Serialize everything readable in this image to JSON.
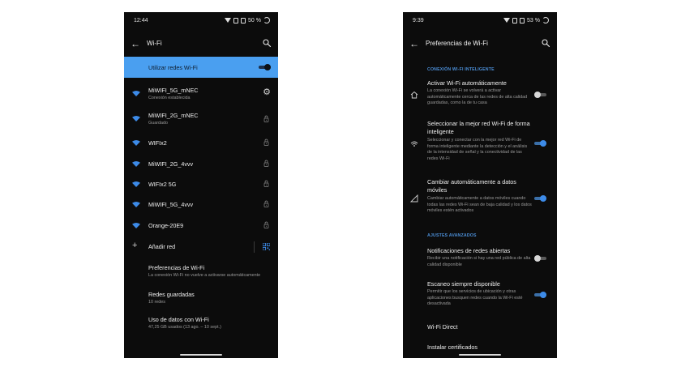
{
  "left_phone": {
    "status": {
      "time": "12:44",
      "battery": "50 %"
    },
    "title": "Wi-Fi",
    "toggle_row": {
      "label": "Utilizar redes Wi-Fi",
      "on": true
    },
    "networks": [
      {
        "name": "MiWIFI_5G_mNEC",
        "status": "Conexión establecida",
        "trailing": "gear-icon"
      },
      {
        "name": "MiWIFI_2G_mNEC",
        "status": "Guardado",
        "trailing": "lock-icon"
      },
      {
        "name": "WIFIx2",
        "status": "",
        "trailing": "lock-icon"
      },
      {
        "name": "MiWIFI_2G_4vvv",
        "status": "",
        "trailing": "lock-icon"
      },
      {
        "name": "WIFIx2 5G",
        "status": "",
        "trailing": "lock-icon"
      },
      {
        "name": "MiWIFI_5G_4vvv",
        "status": "",
        "trailing": "lock-icon"
      },
      {
        "name": "Orange-20E9",
        "status": "",
        "trailing": "lock-icon"
      }
    ],
    "add_network": "Añadir red",
    "menu": [
      {
        "title": "Preferencias de Wi-Fi",
        "subtitle": "La conexión Wi-Fi no vuelve a activarse automáticamente"
      },
      {
        "title": "Redes guardadas",
        "subtitle": "10 redes"
      },
      {
        "title": "Uso de datos con Wi-Fi",
        "subtitle": "47,25 GB usados (13 ago. – 10 sept.)"
      }
    ]
  },
  "right_phone": {
    "status": {
      "time": "9:39",
      "battery": "53 %"
    },
    "title": "Preferencias de Wi-Fi",
    "section1": "CONEXIÓN WI-FI INTELIGENTE",
    "smart_items": [
      {
        "title": "Activar Wi-Fi automáticamente",
        "desc": "La conexión Wi-Fi se volverá a activar automáticamente cerca de las redes de alta calidad guardadas, como la de tu casa",
        "on": false,
        "icon": "home-icon"
      },
      {
        "title": "Seleccionar la mejor red Wi-Fi de forma inteligente",
        "desc": "Seleccionar y conectar con la mejor red Wi-Fi de forma inteligente mediante la detección y el análisis de la intensidad de señal y la conectividad de las redes Wi-Fi",
        "on": true,
        "icon": "wifi-smart-icon"
      },
      {
        "title": "Cambiar automáticamente a datos móviles",
        "desc": "Cambiar automáticamente a datos móviles cuando todas las redes Wi-Fi sean de baja calidad y los datos móviles estén activados",
        "on": true,
        "icon": "mobile-data-icon"
      }
    ],
    "section2": "AJUSTES AVANZADOS",
    "advanced_items": [
      {
        "title": "Notificaciones de redes abiertas",
        "desc": "Recibir una notificación si hay una red pública de alta calidad disponible",
        "on": false
      },
      {
        "title": "Escaneo siempre disponible",
        "desc": "Permitir que los servicios de ubicación y otras aplicaciones busquen redes cuando la Wi-Fi esté desactivada",
        "on": true
      }
    ],
    "plain_items": [
      "Wi-Fi Direct",
      "Instalar certificados"
    ]
  }
}
